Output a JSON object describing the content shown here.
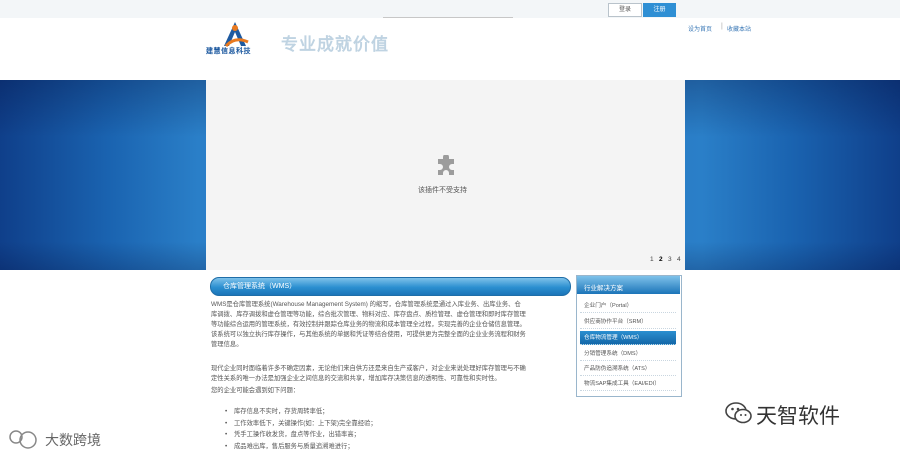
{
  "topbar": {
    "login_label": "登录",
    "register_label": "注册"
  },
  "header": {
    "logo_text": "建慧信息科技",
    "slogan": "专业成就价值",
    "link_home": "设为首页",
    "link_favorite": "收藏本站"
  },
  "banner": {
    "plugin_message": "该插件不受支持",
    "pager": [
      "1",
      "2",
      "3",
      "4"
    ],
    "active_page": "2"
  },
  "section": {
    "title": "仓库管理系统（WMS）",
    "paragraphs": [
      "WMS是仓库管理系统(Warehouse Management System) 的缩写，仓库管理系统是通过入库业务、出库业务、仓",
      "库调拨、库存调拨和虚仓管理等功能，综合批次管理、物料对应、库存盘点、质检管理、虚仓管理和即时库存管理",
      "等功能综合运用的管理系统，有效控制并跟踪仓库业务的物流和成本管理全过程，实现完善的企业仓储信息管理。",
      "该系统可以独立执行库存操作，与其他系统的单据和凭证等结合使用，可提供更为完整全面的企业业务流程和财务",
      "管理信息。",
      "现代企业同时面临着许多不确定因素，无论他们来自供方还是来自生产或客户，对企业来说处理好库存管理与不确",
      "定性关系的唯一办法是加强企业之间信息的交流和共享，增加库存决策信息的透明性、可靠性和实时性。",
      "您的企业可能会遇到如下问题："
    ],
    "bullets": [
      "库存信息不实时，存货周转率低；",
      "工作效率低下，关键操作(如：上下架)完全靠经验；",
      "凭手工操作收发货，盘点等作业，出错率高；",
      "成品难出库，售后服务与质量追溯难进行；"
    ]
  },
  "sidebar": {
    "title": "行业解决方案",
    "items": [
      "企业门户（Portal）",
      "供应商协作平台（SRM）",
      "仓库物流管理（WMS）",
      "分销管理系统（DMS）",
      "产品防伪追溯系统（ATS）",
      "物流SAP集成工具（EAI/EDI）"
    ],
    "active_index": 2
  },
  "watermarks": {
    "right": "天智软件",
    "left": "大数跨境"
  },
  "colors": {
    "accent": "#2f8fd4",
    "banner": "#1f6ab6"
  }
}
